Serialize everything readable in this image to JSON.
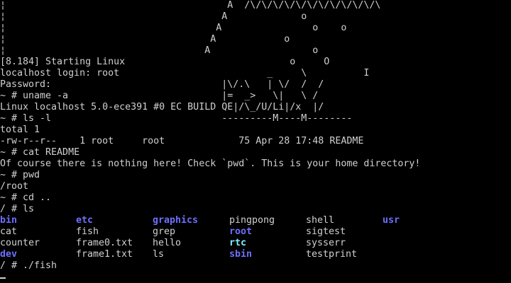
{
  "terminal": {
    "lines": [
      "¦                                       A  /\\/\\/\\/\\/\\/\\/\\/\\/\\/\\/\\/\\",
      "¦                                      A             o",
      "¦                                     A                o    o",
      "¦                                    A            o",
      "¦                                   A                  o",
      "[8.184] Starting Linux                             o     O",
      "localhost login: root                          _     \\          I",
      "Password:                              |\\/.\\   | \\/  /  /",
      "~ # uname -a                           |=  _>   \\|   \\ /",
      "Linux localhost 5.0-ece391 #0 EC BUILD QE|/\\_/U/Li|/x  |/",
      "~ # ls -l                              ---------M----M--------",
      "total 1",
      "-rw-r--r--    1 root     root             75 Apr 28 17:48 README",
      "~ # cat README",
      "Of course there is nothing here! Check `pwd`. This is your home directory!",
      "~ # pwd",
      "/root",
      "~ # cd ..",
      "/ # ls"
    ],
    "ls_rows": [
      [
        "bin",
        "etc",
        "graphics",
        "pingpong",
        "shell",
        "usr"
      ],
      [
        "cat",
        "fish",
        "grep",
        "root",
        "sigtest",
        ""
      ],
      [
        "counter",
        "frame0.txt",
        "hello",
        "rtc",
        "sysserr",
        ""
      ],
      [
        "dev",
        "frame1.txt",
        "ls",
        "sbin",
        "testprint",
        ""
      ]
    ],
    "ls_dir_cells": [
      [
        true,
        true,
        true,
        false,
        false,
        true
      ],
      [
        false,
        false,
        false,
        true,
        false,
        false
      ],
      [
        false,
        false,
        false,
        false,
        false,
        false
      ],
      [
        true,
        false,
        false,
        true,
        false,
        false
      ]
    ],
    "last_prompt": "/ # ./fish",
    "colors": {
      "background": "#000000",
      "text": "#d0d0d0",
      "directory": "#6f6fff",
      "device_or_link": "#7ff0ff"
    }
  }
}
